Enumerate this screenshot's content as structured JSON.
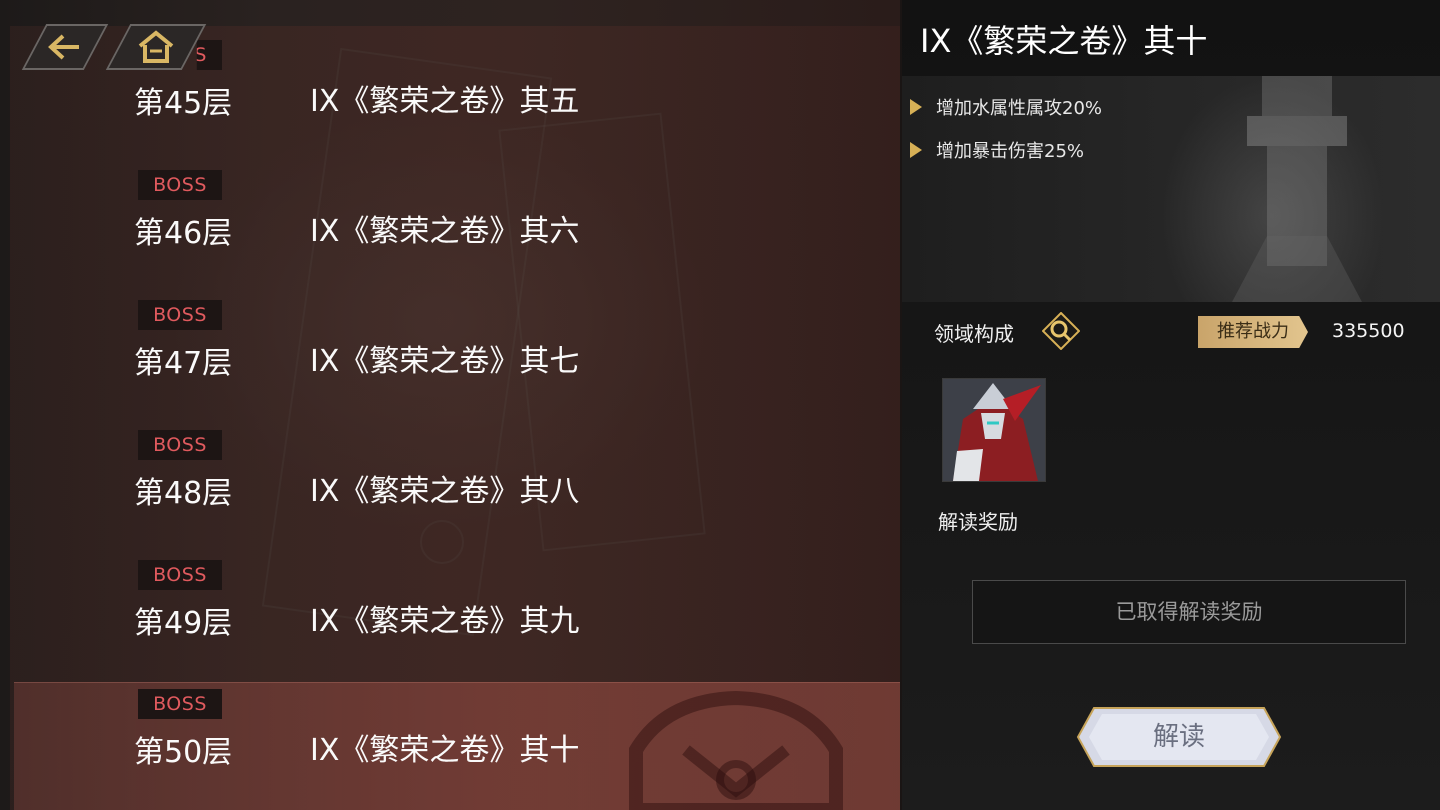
{
  "nav": {
    "back_icon": "back-arrow-icon",
    "home_icon": "home-icon"
  },
  "floors": [
    {
      "badge": "BOSS",
      "floor": "第45层",
      "name": "IX《繁荣之卷》其五",
      "selected": false
    },
    {
      "badge": "BOSS",
      "floor": "第46层",
      "name": "IX《繁荣之卷》其六",
      "selected": false
    },
    {
      "badge": "BOSS",
      "floor": "第47层",
      "name": "IX《繁荣之卷》其七",
      "selected": false
    },
    {
      "badge": "BOSS",
      "floor": "第48层",
      "name": "IX《繁荣之卷》其八",
      "selected": false
    },
    {
      "badge": "BOSS",
      "floor": "第49层",
      "name": "IX《繁荣之卷》其九",
      "selected": false
    },
    {
      "badge": "BOSS",
      "floor": "第50层",
      "name": "IX《繁荣之卷》其十",
      "selected": true
    }
  ],
  "detail": {
    "title": "IX《繁荣之卷》其十",
    "bonuses": [
      "增加水属性属攻20%",
      "增加暴击伤害25%"
    ],
    "domain_label": "领域构成",
    "recommended_label": "推荐战力",
    "recommended_value": "335500",
    "reward_label": "解读奖励",
    "reward_status": "已取得解读奖励",
    "decode_button": "解读"
  },
  "colors": {
    "boss_text": "#e05a5e",
    "gold_accent": "#d7b056",
    "selected_row": "#8c463e"
  }
}
